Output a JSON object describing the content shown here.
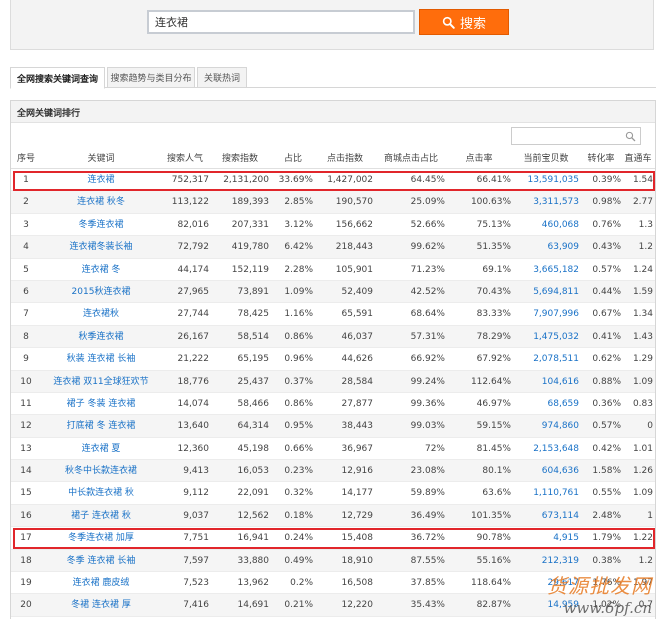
{
  "search": {
    "value": "连衣裙",
    "button_label": "搜索"
  },
  "tabs": [
    {
      "label": "全网搜索关键词查询",
      "active": true
    },
    {
      "label": "搜索趋势与类目分布",
      "active": false
    },
    {
      "label": "关联热词",
      "active": false
    }
  ],
  "panel": {
    "title": "全网关键词排行",
    "filter_placeholder": ""
  },
  "table": {
    "headers": [
      "序号",
      "关键词",
      "搜索人气",
      "搜索指数",
      "占比",
      "点击指数",
      "商城点击占比",
      "点击率",
      "当前宝贝数",
      "转化率",
      "直通车"
    ],
    "rows": [
      [
        "1",
        "连衣裙",
        "752,317",
        "2,131,200",
        "33.69%",
        "1,427,002",
        "64.45%",
        "66.41%",
        "13,591,035",
        "0.39%",
        "1.54"
      ],
      [
        "2",
        "连衣裙 秋冬",
        "113,122",
        "189,393",
        "2.85%",
        "190,570",
        "25.09%",
        "100.63%",
        "3,311,573",
        "0.98%",
        "2.77"
      ],
      [
        "3",
        "冬季连衣裙",
        "82,016",
        "207,331",
        "3.12%",
        "156,662",
        "52.66%",
        "75.13%",
        "460,068",
        "0.76%",
        "1.3"
      ],
      [
        "4",
        "连衣裙冬装长袖",
        "72,792",
        "419,780",
        "6.42%",
        "218,443",
        "99.62%",
        "51.35%",
        "63,909",
        "0.43%",
        "1.2"
      ],
      [
        "5",
        "连衣裙 冬",
        "44,174",
        "152,119",
        "2.28%",
        "105,901",
        "71.23%",
        "69.1%",
        "3,665,182",
        "0.57%",
        "1.24"
      ],
      [
        "6",
        "2015秋连衣裙",
        "27,965",
        "73,891",
        "1.09%",
        "52,409",
        "42.52%",
        "70.43%",
        "5,694,811",
        "0.44%",
        "1.59"
      ],
      [
        "7",
        "连衣裙秋",
        "27,744",
        "78,425",
        "1.16%",
        "65,591",
        "68.64%",
        "83.33%",
        "7,907,996",
        "0.67%",
        "1.34"
      ],
      [
        "8",
        "秋季连衣裙",
        "26,167",
        "58,514",
        "0.86%",
        "46,037",
        "57.31%",
        "78.29%",
        "1,475,032",
        "0.41%",
        "1.43"
      ],
      [
        "9",
        "秋装 连衣裙 长袖",
        "21,222",
        "65,195",
        "0.96%",
        "44,626",
        "66.92%",
        "67.92%",
        "2,078,511",
        "0.62%",
        "1.29"
      ],
      [
        "10",
        "连衣裙 双11全球狂欢节",
        "18,776",
        "25,437",
        "0.37%",
        "28,584",
        "99.24%",
        "112.64%",
        "104,616",
        "0.88%",
        "1.09"
      ],
      [
        "11",
        "裙子 冬装 连衣裙",
        "14,074",
        "58,466",
        "0.86%",
        "27,877",
        "99.36%",
        "46.97%",
        "68,659",
        "0.36%",
        "0.83"
      ],
      [
        "12",
        "打底裙 冬 连衣裙",
        "13,640",
        "64,314",
        "0.95%",
        "38,443",
        "99.03%",
        "59.15%",
        "974,860",
        "0.57%",
        "0"
      ],
      [
        "13",
        "连衣裙 夏",
        "12,360",
        "45,198",
        "0.66%",
        "36,967",
        "72%",
        "81.45%",
        "2,153,648",
        "0.42%",
        "1.01"
      ],
      [
        "14",
        "秋冬中长款连衣裙",
        "9,413",
        "16,053",
        "0.23%",
        "12,916",
        "23.08%",
        "80.1%",
        "604,636",
        "1.58%",
        "1.26"
      ],
      [
        "15",
        "中长款连衣裙 秋",
        "9,112",
        "22,091",
        "0.32%",
        "14,177",
        "59.89%",
        "63.6%",
        "1,110,761",
        "0.55%",
        "1.09"
      ],
      [
        "16",
        "裙子 连衣裙 秋",
        "9,037",
        "12,562",
        "0.18%",
        "12,729",
        "36.49%",
        "101.35%",
        "673,114",
        "2.48%",
        "1"
      ],
      [
        "17",
        "冬季连衣裙 加厚",
        "7,751",
        "16,941",
        "0.24%",
        "15,408",
        "36.72%",
        "90.78%",
        "4,915",
        "1.79%",
        "1.22"
      ],
      [
        "18",
        "冬季 连衣裙 长袖",
        "7,597",
        "33,880",
        "0.49%",
        "18,910",
        "87.55%",
        "55.16%",
        "212,319",
        "0.38%",
        "1.2"
      ],
      [
        "19",
        "连衣裙 鹿皮绒",
        "7,523",
        "13,962",
        "0.2%",
        "16,508",
        "37.85%",
        "118.64%",
        "29,617",
        "1.76%",
        "1.97"
      ],
      [
        "20",
        "冬裙 连衣裙 厚",
        "7,416",
        "14,691",
        "0.21%",
        "12,220",
        "35.43%",
        "82.87%",
        "14,959",
        "1.02%",
        "0.7"
      ]
    ]
  },
  "watermark": {
    "cn": "货源批发网",
    "url": "www.6pf.cn"
  },
  "colors": {
    "accent": "#ff6d0c",
    "link": "#1a72c7",
    "highlight": "#e1262b"
  }
}
